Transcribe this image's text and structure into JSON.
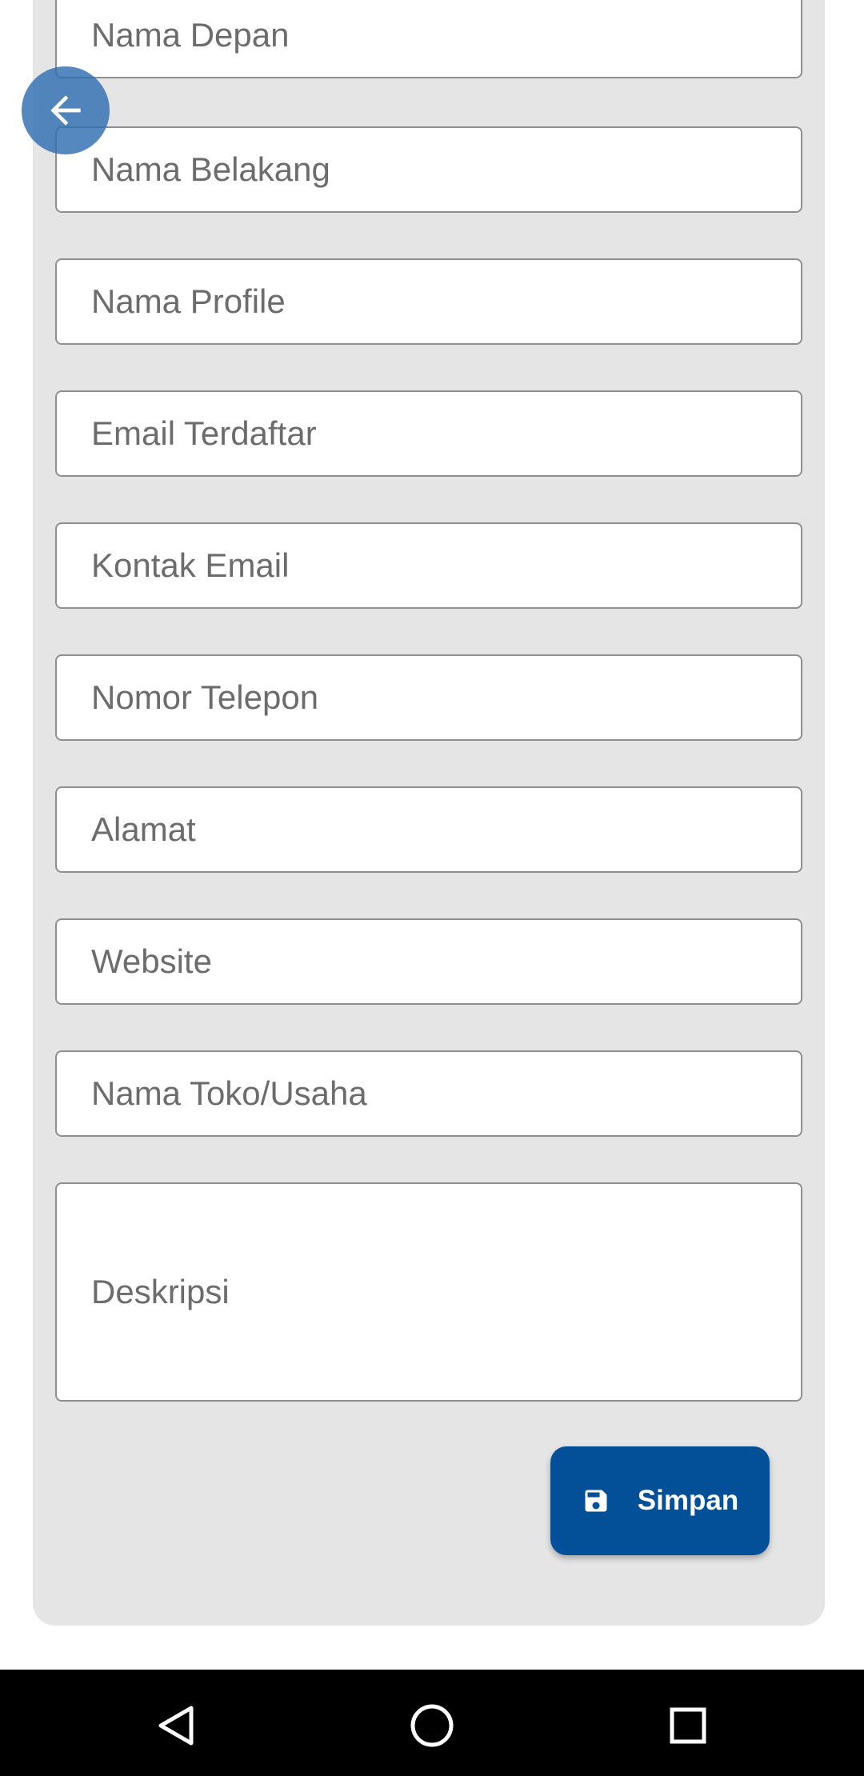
{
  "form": {
    "fields": [
      {
        "placeholder": "Nama Depan"
      },
      {
        "placeholder": "Nama Belakang"
      },
      {
        "placeholder": "Nama Profile"
      },
      {
        "placeholder": "Email Terdaftar"
      },
      {
        "placeholder": "Kontak Email"
      },
      {
        "placeholder": "Nomor Telepon"
      },
      {
        "placeholder": "Alamat"
      },
      {
        "placeholder": "Website"
      },
      {
        "placeholder": "Nama Toko/Usaha"
      },
      {
        "placeholder": "Deskripsi"
      }
    ],
    "save_label": "Simpan",
    "save_icon": "floppy-disk-icon"
  },
  "back_button": {
    "icon": "arrow-left-icon"
  },
  "nav": {
    "back_icon": "triangle-back-icon",
    "home_icon": "circle-home-icon",
    "recents_icon": "square-recents-icon"
  },
  "colors": {
    "primary": "#034f98",
    "back_button": "#2f6eb0",
    "panel": "#e5e5e5"
  }
}
